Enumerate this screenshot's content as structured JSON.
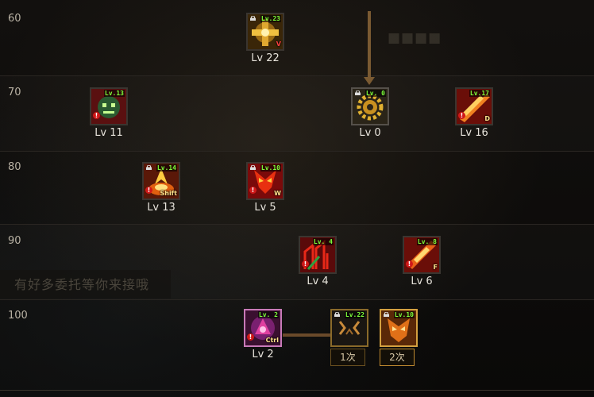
{
  "levels": [
    "60",
    "70",
    "80",
    "90",
    "100"
  ],
  "skills": [
    {
      "id": "s60",
      "badge": "Lv.23",
      "hotkey": "V",
      "level": "Lv 22",
      "theme": "gold-cross"
    },
    {
      "id": "s70a",
      "badge": "Lv.13",
      "hotkey": "",
      "level": "Lv 11",
      "theme": "green-face"
    },
    {
      "id": "s70b",
      "badge": "Lv. 0",
      "hotkey": "",
      "level": "Lv 0",
      "theme": "gear"
    },
    {
      "id": "s70c",
      "badge": "Lv.17",
      "hotkey": "D",
      "level": "Lv 16",
      "theme": "red-slash"
    },
    {
      "id": "s80a",
      "badge": "Lv.14",
      "hotkey": "Shift",
      "level": "Lv 13",
      "theme": "fire"
    },
    {
      "id": "s80b",
      "badge": "Lv.10",
      "hotkey": "W",
      "level": "Lv 5",
      "theme": "red-mask"
    },
    {
      "id": "s90a",
      "badge": "Lv. 4",
      "hotkey": "",
      "level": "Lv 4",
      "theme": "red-lines"
    },
    {
      "id": "s90b",
      "badge": "Lv. 8",
      "hotkey": "F",
      "level": "Lv 6",
      "theme": "red-slash"
    },
    {
      "id": "s100a",
      "badge": "Lv. 2",
      "hotkey": "Ctrl",
      "level": "Lv 2",
      "theme": "purple"
    },
    {
      "id": "s100b",
      "badge": "Lv.22",
      "hotkey": "",
      "level": "1次",
      "theme": "dark-claw"
    },
    {
      "id": "s100c",
      "badge": "Lv.10",
      "hotkey": "",
      "level": "2次",
      "theme": "orange-mask"
    }
  ],
  "watermark": "有好多委托等你来接哦",
  "colors": {
    "badge": "#7dff3a",
    "connector": "#7a5a32",
    "warn": "#d01818",
    "hotkey": "#ffe08a"
  }
}
